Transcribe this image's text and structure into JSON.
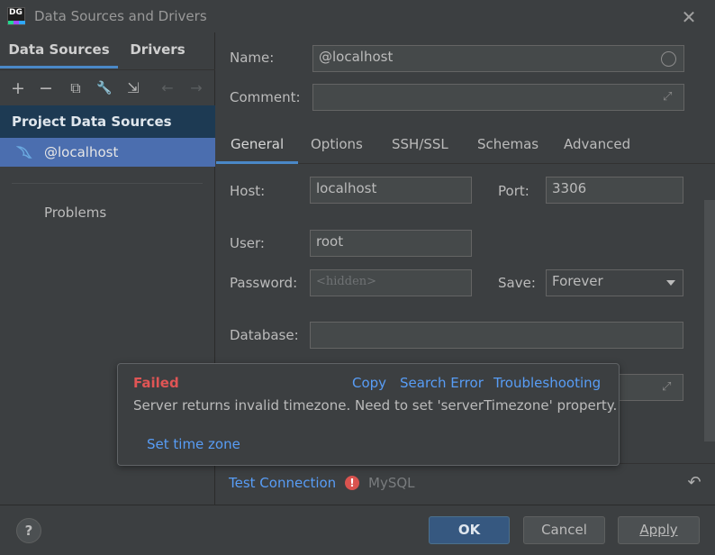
{
  "window": {
    "title": "Data Sources and Drivers",
    "app_icon_text": "DG"
  },
  "left": {
    "tabs": [
      {
        "label": "Data Sources"
      },
      {
        "label": "Drivers"
      }
    ],
    "toolbar": {
      "add": "+",
      "remove": "−",
      "duplicate": "⧉",
      "properties": "🔧",
      "import": "⇲",
      "back": "←",
      "forward": "→"
    },
    "section_header": "Project Data Sources",
    "items": [
      {
        "label": "@localhost"
      }
    ],
    "problems": "Problems"
  },
  "form": {
    "name_label": "Name:",
    "name_value": "@localhost",
    "comment_label": "Comment:",
    "comment_value": "",
    "tabs": [
      {
        "label": "General"
      },
      {
        "label": "Options"
      },
      {
        "label": "SSH/SSL"
      },
      {
        "label": "Schemas"
      },
      {
        "label": "Advanced"
      }
    ],
    "host_label": "Host:",
    "host_value": "localhost",
    "port_label": "Port:",
    "port_value": "3306",
    "user_label": "User:",
    "user_value": "root",
    "password_label": "Password:",
    "password_value": "<hidden>",
    "save_label": "Save:",
    "save_value": "Forever",
    "database_label": "Database:",
    "database_value": ""
  },
  "popup": {
    "status": "Failed",
    "links": {
      "copy": "Copy",
      "search_error": "Search Error",
      "troubleshooting": "Troubleshooting"
    },
    "message": "Server returns invalid timezone. Need to set 'serverTimezone' property.",
    "action": "Set time zone"
  },
  "bottom": {
    "test_connection": "Test Connection",
    "error_icon": "!",
    "driver": "MySQL"
  },
  "footer": {
    "help": "?",
    "ok": "OK",
    "cancel": "Cancel",
    "apply": "Apply"
  },
  "colors": {
    "link": "#589df6",
    "error": "#e05555",
    "selection": "#4b6eaf",
    "section_header_bg": "#1d3a53",
    "primary_button": "#365880"
  }
}
